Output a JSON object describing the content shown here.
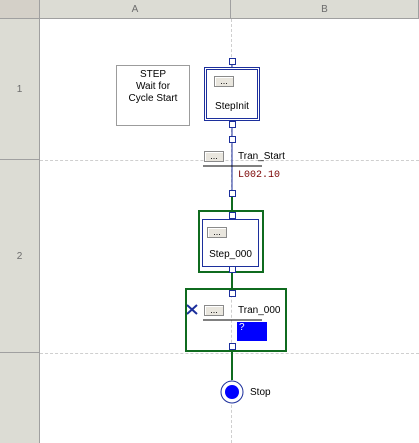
{
  "columns": [
    {
      "label": "A"
    },
    {
      "label": "B"
    }
  ],
  "rows": [
    {
      "label": "1"
    },
    {
      "label": "2"
    }
  ],
  "comment": {
    "line1": "STEP",
    "line2": "Wait for",
    "line3": "Cycle Start"
  },
  "ellipsis": "...",
  "step_init": {
    "name": "StepInit"
  },
  "tran_start": {
    "name": "Tran_Start",
    "condition": "L002.10"
  },
  "step_000": {
    "name": "Step_000"
  },
  "tran_000": {
    "name": "Tran_000",
    "condition": "?"
  },
  "stop": {
    "label": "Stop"
  },
  "colors": {
    "step_border": "#1c2f9c",
    "selected_border": "#0f6b1f",
    "link_selected": "#0f6b1f",
    "condition_text": "#7a0000",
    "highlight": "#0000ff"
  }
}
